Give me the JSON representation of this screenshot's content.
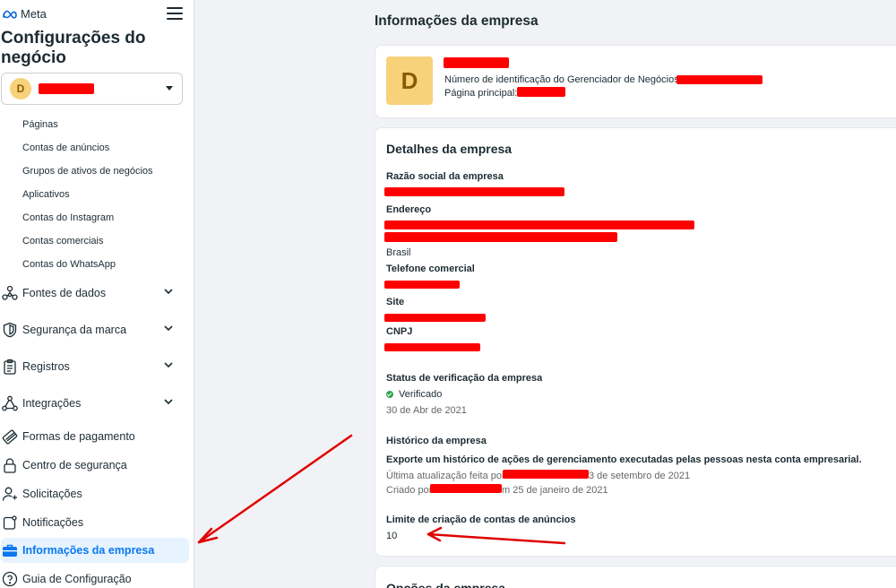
{
  "brand": {
    "name": "Meta"
  },
  "sidebar": {
    "title": "Configurações do negócio",
    "business_avatar": "D",
    "sub_items": [
      "Páginas",
      "Contas de anúncios",
      "Grupos de ativos de negócios",
      "Aplicativos",
      "Contas do Instagram",
      "Contas comerciais",
      "Contas do WhatsApp"
    ],
    "nav_items": [
      {
        "label": "Fontes de dados",
        "icon": "data-sources-icon",
        "expandable": true
      },
      {
        "label": "Segurança da marca",
        "icon": "shield-icon",
        "expandable": true
      },
      {
        "label": "Registros",
        "icon": "clipboard-icon",
        "expandable": true
      },
      {
        "label": "Integrações",
        "icon": "integrations-icon",
        "expandable": true
      },
      {
        "label": "Formas de pagamento",
        "icon": "credit-card-icon",
        "expandable": false
      },
      {
        "label": "Centro de segurança",
        "icon": "lock-icon",
        "expandable": false
      },
      {
        "label": "Solicitações",
        "icon": "person-request-icon",
        "expandable": false
      },
      {
        "label": "Notificações",
        "icon": "notification-icon",
        "expandable": false
      },
      {
        "label": "Informações da empresa",
        "icon": "briefcase-icon",
        "expandable": false,
        "active": true
      },
      {
        "label": "Guia de Configuração",
        "icon": "help-icon",
        "expandable": false
      }
    ]
  },
  "main": {
    "title": "Informações da empresa",
    "header_card": {
      "avatar": "D",
      "id_label": "Número de identificação do Gerenciador de Negócios:",
      "page_label": "Página principal:"
    },
    "details": {
      "title": "Detalhes da empresa",
      "legal_name_label": "Razão social da empresa",
      "address_label": "Endereço",
      "country": "Brasil",
      "phone_label": "Telefone comercial",
      "site_label": "Site",
      "cnpj_label": "CNPJ",
      "verification_label": "Status de verificação da empresa",
      "verification_status": "Verificado",
      "verification_date": "30 de Abr de 2021",
      "history_label": "Histórico da empresa",
      "history_desc": "Exporte um histórico de ações de gerenciamento executadas pelas pessoas nesta conta empresarial.",
      "last_update_prefix": "Última atualização feita por",
      "last_update_suffix": "3 de setembro de 2021",
      "created_prefix": "Criado por",
      "created_suffix": "m 25 de janeiro de 2021",
      "ad_limit_label": "Limite de criação de contas de anúncios",
      "ad_limit_value": "10"
    },
    "options_title": "Opções da empresa"
  },
  "colors": {
    "accent": "#0a78ef",
    "redaction": "#ff0000",
    "avatar_bg": "#f7d27a",
    "success": "#31a24c"
  }
}
